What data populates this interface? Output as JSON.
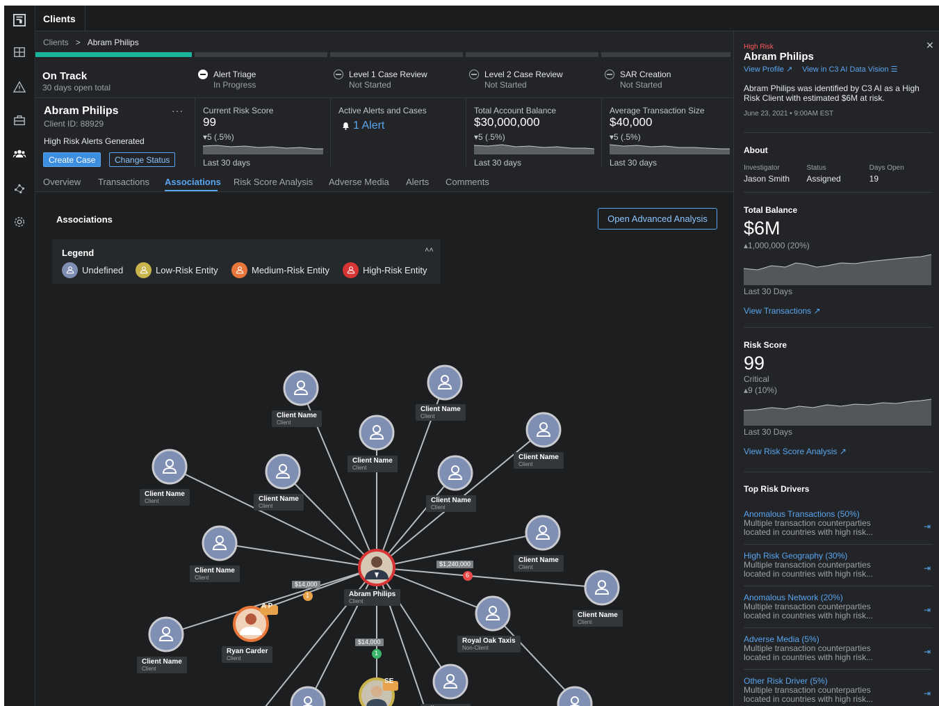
{
  "app": {
    "tab_title": "Clients"
  },
  "breadcrumb": {
    "root": "Clients",
    "separator": ">",
    "current": "Abram Philips"
  },
  "workflow": {
    "status_title": "On Track",
    "status_sub": "30 days open total",
    "steps": [
      {
        "title": "Alert Triage",
        "status": "In Progress"
      },
      {
        "title": "Level 1 Case Review",
        "status": "Not Started"
      },
      {
        "title": "Level 2 Case Review",
        "status": "Not Started"
      },
      {
        "title": "SAR Creation",
        "status": "Not Started"
      }
    ]
  },
  "client": {
    "name": "Abram Philips",
    "id": "Client ID: 88929",
    "more": "···",
    "alerts_generated": "High Risk Alerts Generated",
    "create_case": "Create Case",
    "change_status": "Change Status"
  },
  "metrics": {
    "risk": {
      "label": "Current Risk Score",
      "value": "99",
      "change": "▾5 (.5%)",
      "period": "Last 30 days"
    },
    "alerts": {
      "label": "Active Alerts and Cases",
      "value": "1 Alert"
    },
    "balance": {
      "label": "Total Account Balance",
      "value": "$30,000,000",
      "change": "▾5 (.5%)",
      "period": "Last 30 days"
    },
    "avg_txn": {
      "label": "Average Transaction Size",
      "value": "$40,000",
      "change": "▾5 (.5%)",
      "period": "Last 30 days"
    }
  },
  "tabs": [
    "Overview",
    "Transactions",
    "Associations",
    "Risk Score Analysis",
    "Adverse Media",
    "Alerts",
    "Comments"
  ],
  "associations": {
    "title": "Associations",
    "advanced_button": "Open Advanced Analysis",
    "legend_title": "Legend",
    "legend_items": [
      "Undefined",
      "Low-Risk Entity",
      "Medium-Risk Entity",
      "High-Risk Entity"
    ],
    "legend_colors": [
      "#7f8fb3",
      "#c8b44a",
      "#e8763a",
      "#d83434"
    ],
    "center": {
      "name": "Abram Philips",
      "kind": "Client"
    },
    "generic_name": "Client Name",
    "generic_kind": "Client",
    "ryan": {
      "name": "Ryan Carder",
      "kind": "Client",
      "badge": "A P"
    },
    "royal": {
      "name": "Royal Oak Taxis",
      "kind": "Non-Client"
    },
    "se_badge": "SE",
    "amounts": [
      "$1,240,000",
      "$14,000",
      "$14,000"
    ],
    "edge_counts": [
      "6",
      "1",
      "1"
    ]
  },
  "side": {
    "risk_tag": "High Risk",
    "name": "Abram Philips",
    "link_profile": "View Profile",
    "link_vision": "View in C3 AI Data Vision",
    "description": "Abram Philips was identified by C3 AI as a High Risk Client with estimated $6M at risk.",
    "date": "June 23, 2021 • 9:00AM EST",
    "about_title": "About",
    "about": [
      {
        "k": "Investigator",
        "v": "Jason Smith"
      },
      {
        "k": "Status",
        "v": "Assigned"
      },
      {
        "k": "Days Open",
        "v": "19"
      }
    ],
    "balance_title": "Total Balance",
    "balance_value": "$6M",
    "balance_change": "▴1,000,000 (20%)",
    "balance_period": "Last 30 Days",
    "view_transactions": "View Transactions",
    "risk_title": "Risk Score",
    "risk_value": "99",
    "risk_level": "Critical",
    "risk_change": "▴9 (10%)",
    "risk_period": "Last 30 Days",
    "view_risk": "View Risk Score Analysis",
    "drivers_title": "Top Risk Drivers",
    "drivers": [
      {
        "title": "Anomalous Transactions (50%)",
        "desc": "Multiple transaction counterparties located in countries with high risk..."
      },
      {
        "title": "High Risk Geography (30%)",
        "desc": "Multiple transaction counterparties located in countries with high risk..."
      },
      {
        "title": "Anomalous Network (20%)",
        "desc": "Multiple transaction counterparties located in countries with high risk..."
      },
      {
        "title": "Adverse Media (5%)",
        "desc": "Multiple transaction counterparties located in countries with high risk..."
      },
      {
        "title": "Other Risk Driver (5%)",
        "desc": "Multiple transaction counterparties located in countries with high risk..."
      }
    ]
  }
}
